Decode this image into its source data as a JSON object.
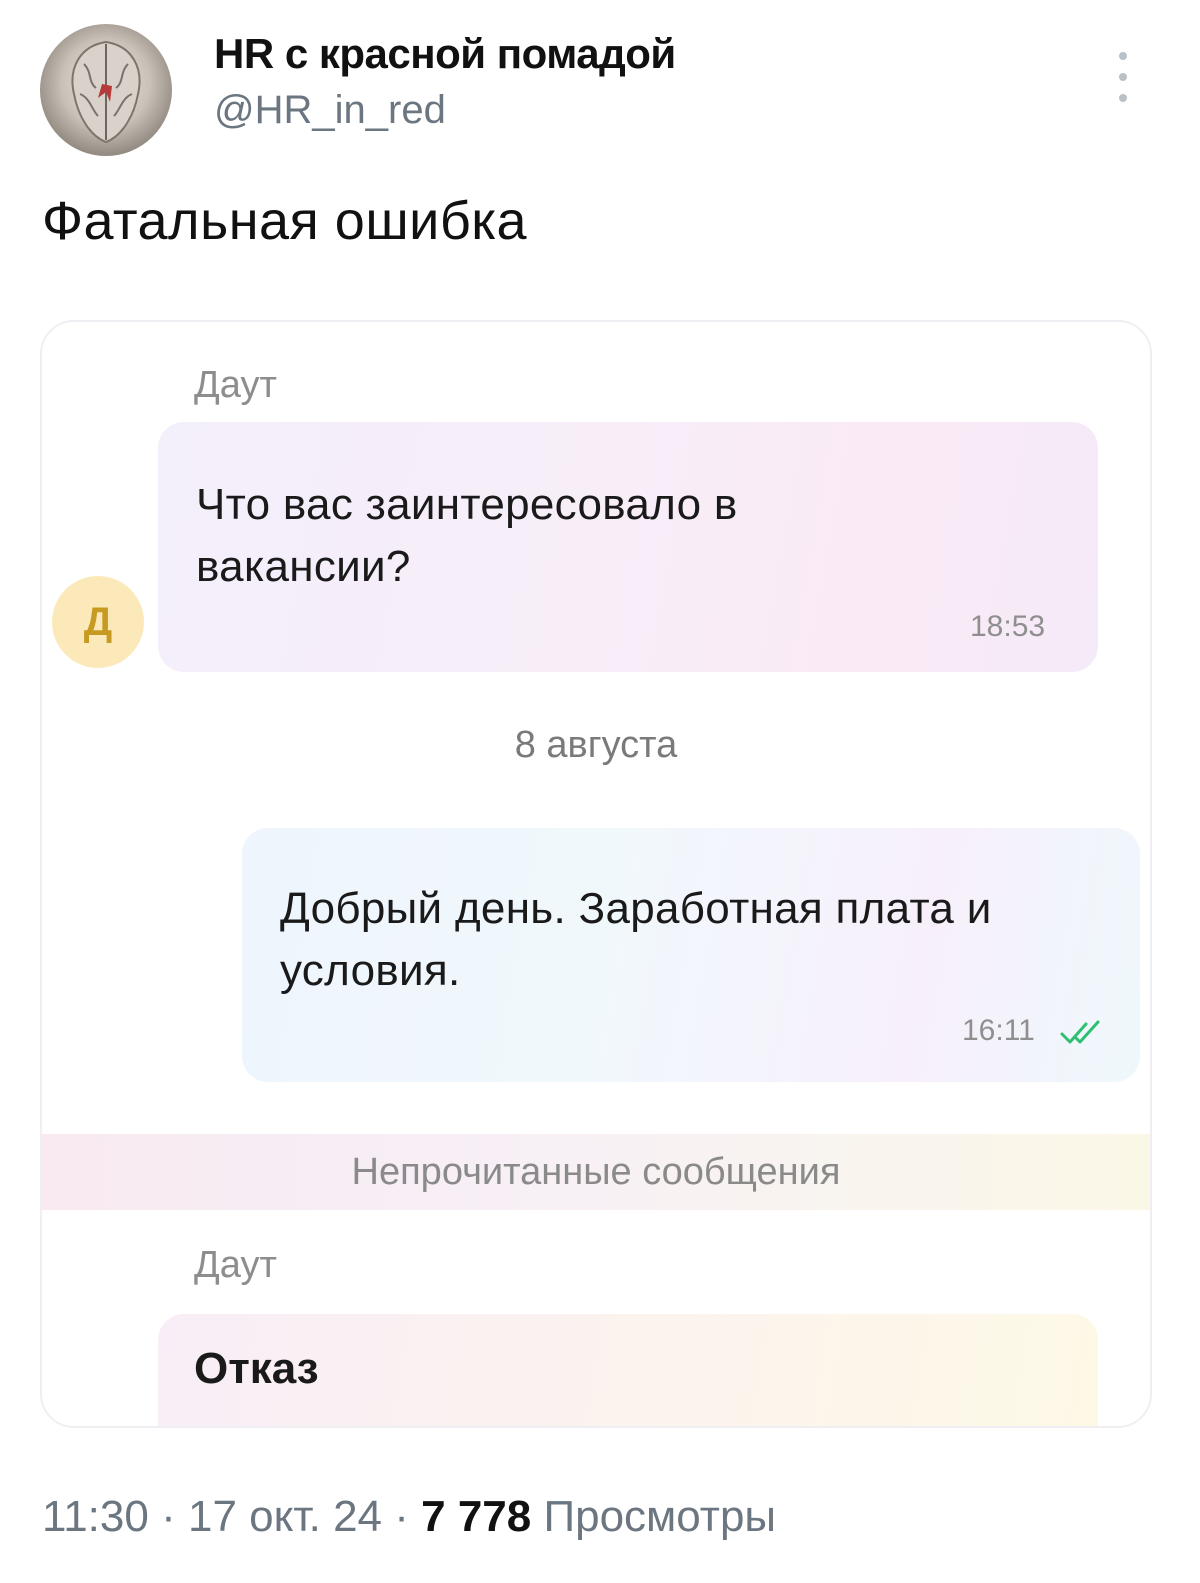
{
  "author": {
    "display_name": "HR с красной помадой",
    "handle": "@HR_in_red"
  },
  "tweet": {
    "text": "Фатальная ошибка",
    "time": "11:30",
    "date": "17 окт. 24",
    "separator": "·",
    "views_count": "7 778",
    "views_label": "Просмотры"
  },
  "chat": {
    "messages": [
      {
        "sender": "Даут",
        "text": "Что вас заинтересовало в вакансии?",
        "time": "18:53",
        "avatar_letter": "Д"
      },
      {
        "text": "Добрый день. Заработная плата и условия.",
        "time": "16:11",
        "status_icon": "double-check-icon"
      },
      {
        "sender": "Даут",
        "text": "Отказ"
      }
    ],
    "date_divider": "8 августа",
    "unread_banner": "Непрочитанные сообщения"
  },
  "colors": {
    "check_color": "#2fbf71",
    "avatar_bg": "#fbe9b9",
    "avatar_letter": "#c79a22"
  }
}
